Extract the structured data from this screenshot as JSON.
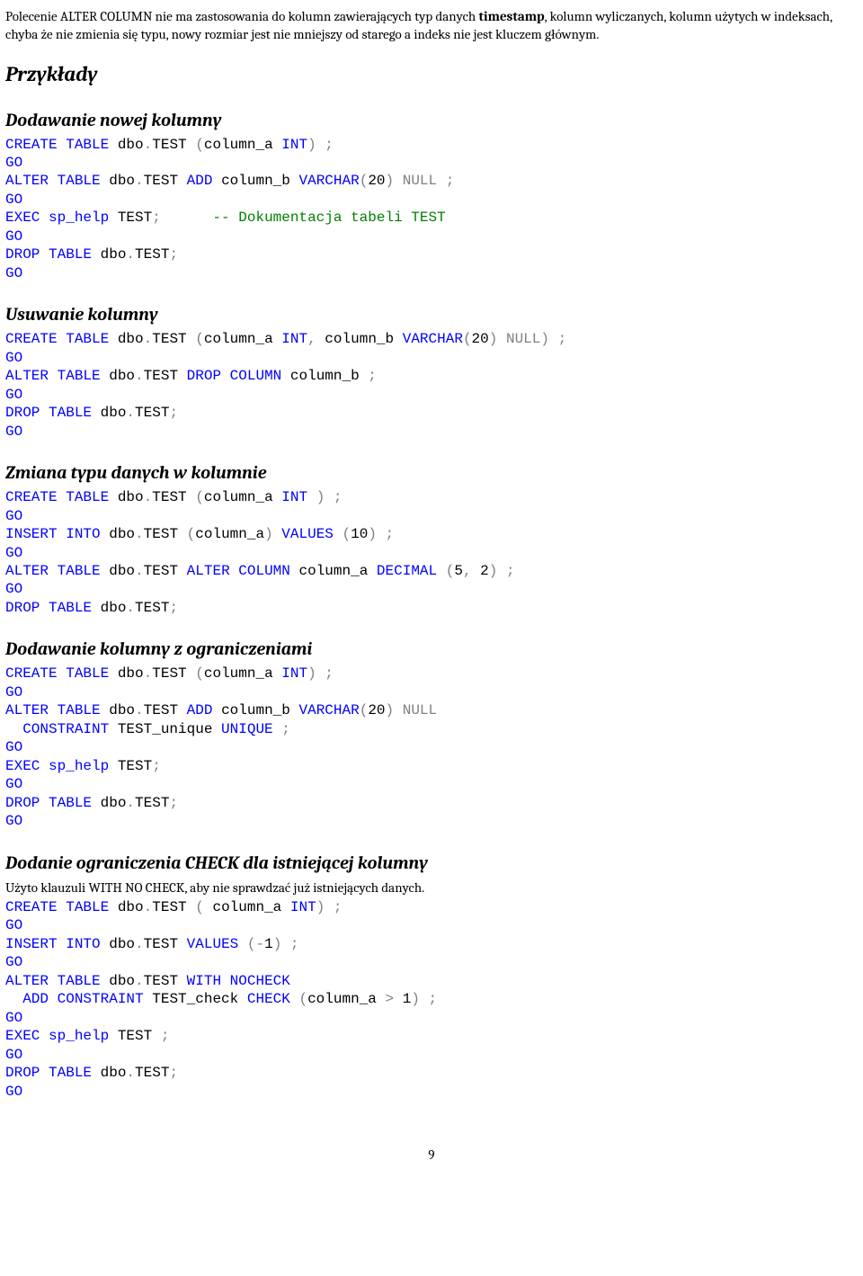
{
  "intro": {
    "p1a": "Polecenie ALTER COLUMN nie ma zastosowania do kolumn zawierających typ danych ",
    "p1b": "timestamp",
    "p1c": ", kolumn wyliczanych, kolumn użytych w indeksach, chyba że nie zmienia się typu, nowy rozmiar jest nie mniejszy od starego a indeks nie jest kluczem głównym."
  },
  "h_examples": "Przykłady",
  "sec1": {
    "title": "Dodawanie nowej kolumny",
    "l1a": "CREATE",
    "l1b": " TABLE",
    "l1c": " dbo",
    "l1d": ".",
    "l1e": "TEST ",
    "l1f": "(",
    "l1g": "column_a ",
    "l1h": "INT",
    "l1i": ")",
    "l1j": " ;",
    "l2": "GO",
    "l3a": "ALTER",
    "l3b": " TABLE",
    "l3c": " dbo",
    "l3d": ".",
    "l3e": "TEST ",
    "l3f": "ADD",
    "l3g": " column_b ",
    "l3h": "VARCHAR",
    "l3i": "(",
    "l3j": "20",
    "l3k": ")",
    "l3l": " NULL",
    "l3m": " ;",
    "l4": "GO",
    "l5a": "EXEC",
    "l5b": " sp_help",
    "l5c": " TEST",
    "l5d": ";",
    "l5pad": "      ",
    "l5e": "-- Dokumentacja tabeli TEST",
    "l6": "GO",
    "l7a": "DROP",
    "l7b": " TABLE",
    "l7c": " dbo",
    "l7d": ".",
    "l7e": "TEST",
    "l7f": ";",
    "l8": "GO"
  },
  "sec2": {
    "title": "Usuwanie kolumny",
    "l1a": "CREATE",
    "l1b": " TABLE",
    "l1c": " dbo",
    "l1d": ".",
    "l1e": "TEST ",
    "l1f": "(",
    "l1g": "column_a ",
    "l1h": "INT",
    "l1i": ",",
    "l1j": " column_b ",
    "l1k": "VARCHAR",
    "l1l": "(",
    "l1m": "20",
    "l1n": ")",
    "l1o": " NULL",
    "l1p": ")",
    "l1q": " ;",
    "l2": "GO",
    "l3a": "ALTER",
    "l3b": " TABLE",
    "l3c": " dbo",
    "l3d": ".",
    "l3e": "TEST ",
    "l3f": "DROP",
    "l3g": " COLUMN",
    "l3h": " column_b ",
    "l3i": ";",
    "l4": "GO",
    "l5a": "DROP",
    "l5b": " TABLE",
    "l5c": " dbo",
    "l5d": ".",
    "l5e": "TEST",
    "l5f": ";",
    "l6": "GO"
  },
  "sec3": {
    "title": "Zmiana typu danych w kolumnie",
    "l1a": "CREATE",
    "l1b": " TABLE",
    "l1c": " dbo",
    "l1d": ".",
    "l1e": "TEST ",
    "l1f": "(",
    "l1g": "column_a ",
    "l1h": "INT",
    "l1i": " )",
    "l1j": " ;",
    "l2": "GO",
    "l3a": "INSERT",
    "l3b": " INTO",
    "l3c": " dbo",
    "l3d": ".",
    "l3e": "TEST ",
    "l3f": "(",
    "l3g": "column_a",
    "l3h": ")",
    "l3i": " VALUES",
    "l3j": " (",
    "l3k": "10",
    "l3l": ")",
    "l3m": " ;",
    "l4": "GO",
    "l5a": "ALTER",
    "l5b": " TABLE",
    "l5c": " dbo",
    "l5d": ".",
    "l5e": "TEST ",
    "l5f": "ALTER",
    "l5g": " COLUMN",
    "l5h": " column_a ",
    "l5i": "DECIMAL",
    "l5j": " (",
    "l5k": "5",
    "l5l": ",",
    "l5m": " 2",
    "l5n": ")",
    "l5o": " ;",
    "l6": "GO",
    "l7a": "DROP",
    "l7b": " TABLE",
    "l7c": " dbo",
    "l7d": ".",
    "l7e": "TEST",
    "l7f": ";"
  },
  "sec4": {
    "title": "Dodawanie kolumny z ograniczeniami",
    "l1a": "CREATE",
    "l1b": " TABLE",
    "l1c": " dbo",
    "l1d": ".",
    "l1e": "TEST ",
    "l1f": "(",
    "l1g": "column_a ",
    "l1h": "INT",
    "l1i": ")",
    "l1j": " ;",
    "l2": "GO",
    "l3a": "ALTER",
    "l3b": " TABLE",
    "l3c": " dbo",
    "l3d": ".",
    "l3e": "TEST ",
    "l3f": "ADD",
    "l3g": " column_b ",
    "l3h": "VARCHAR",
    "l3i": "(",
    "l3j": "20",
    "l3k": ")",
    "l3l": " NULL",
    "l4pad": "  ",
    "l4a": "CONSTRAINT",
    "l4b": " TEST_unique ",
    "l4c": "UNIQUE",
    "l4d": " ;",
    "l5": "GO",
    "l6a": "EXEC",
    "l6b": " sp_help",
    "l6c": " TEST",
    "l6d": ";",
    "l7": "GO",
    "l8a": "DROP",
    "l8b": " TABLE",
    "l8c": " dbo",
    "l8d": ".",
    "l8e": "TEST",
    "l8f": ";",
    "l9": "GO"
  },
  "sec5": {
    "title": "Dodanie ograniczenia CHECK dla istniejącej kolumny",
    "note": "Użyto klauzuli WITH NO CHECK, aby nie sprawdzać już istniejących danych.",
    "l1a": "CREATE",
    "l1b": " TABLE",
    "l1c": " dbo",
    "l1d": ".",
    "l1e": "TEST ",
    "l1f": "(",
    "l1g": " column_a ",
    "l1h": "INT",
    "l1i": ")",
    "l1j": " ;",
    "l2": "GO",
    "l3a": "INSERT",
    "l3b": " INTO",
    "l3c": " dbo",
    "l3d": ".",
    "l3e": "TEST ",
    "l3f": "VALUES",
    "l3g": " (-",
    "l3h": "1",
    "l3i": ")",
    "l3j": " ;",
    "l4": "GO",
    "l5a": "ALTER",
    "l5b": " TABLE",
    "l5c": " dbo",
    "l5d": ".",
    "l5e": "TEST ",
    "l5f": "WITH",
    "l5g": " NOCHECK",
    "l6pad": "  ",
    "l6a": "ADD",
    "l6b": " CONSTRAINT",
    "l6c": " TEST_check ",
    "l6d": "CHECK",
    "l6e": " (",
    "l6f": "column_a ",
    "l6g": ">",
    "l6h": " 1",
    "l6i": ")",
    "l6j": " ;",
    "l7": "GO",
    "l8a": "EXEC",
    "l8b": " sp_help",
    "l8c": " TEST ",
    "l8d": ";",
    "l9": "GO",
    "l10a": "DROP",
    "l10b": " TABLE",
    "l10c": " dbo",
    "l10d": ".",
    "l10e": "TEST",
    "l10f": ";",
    "l11": "GO"
  },
  "page_number": "9"
}
